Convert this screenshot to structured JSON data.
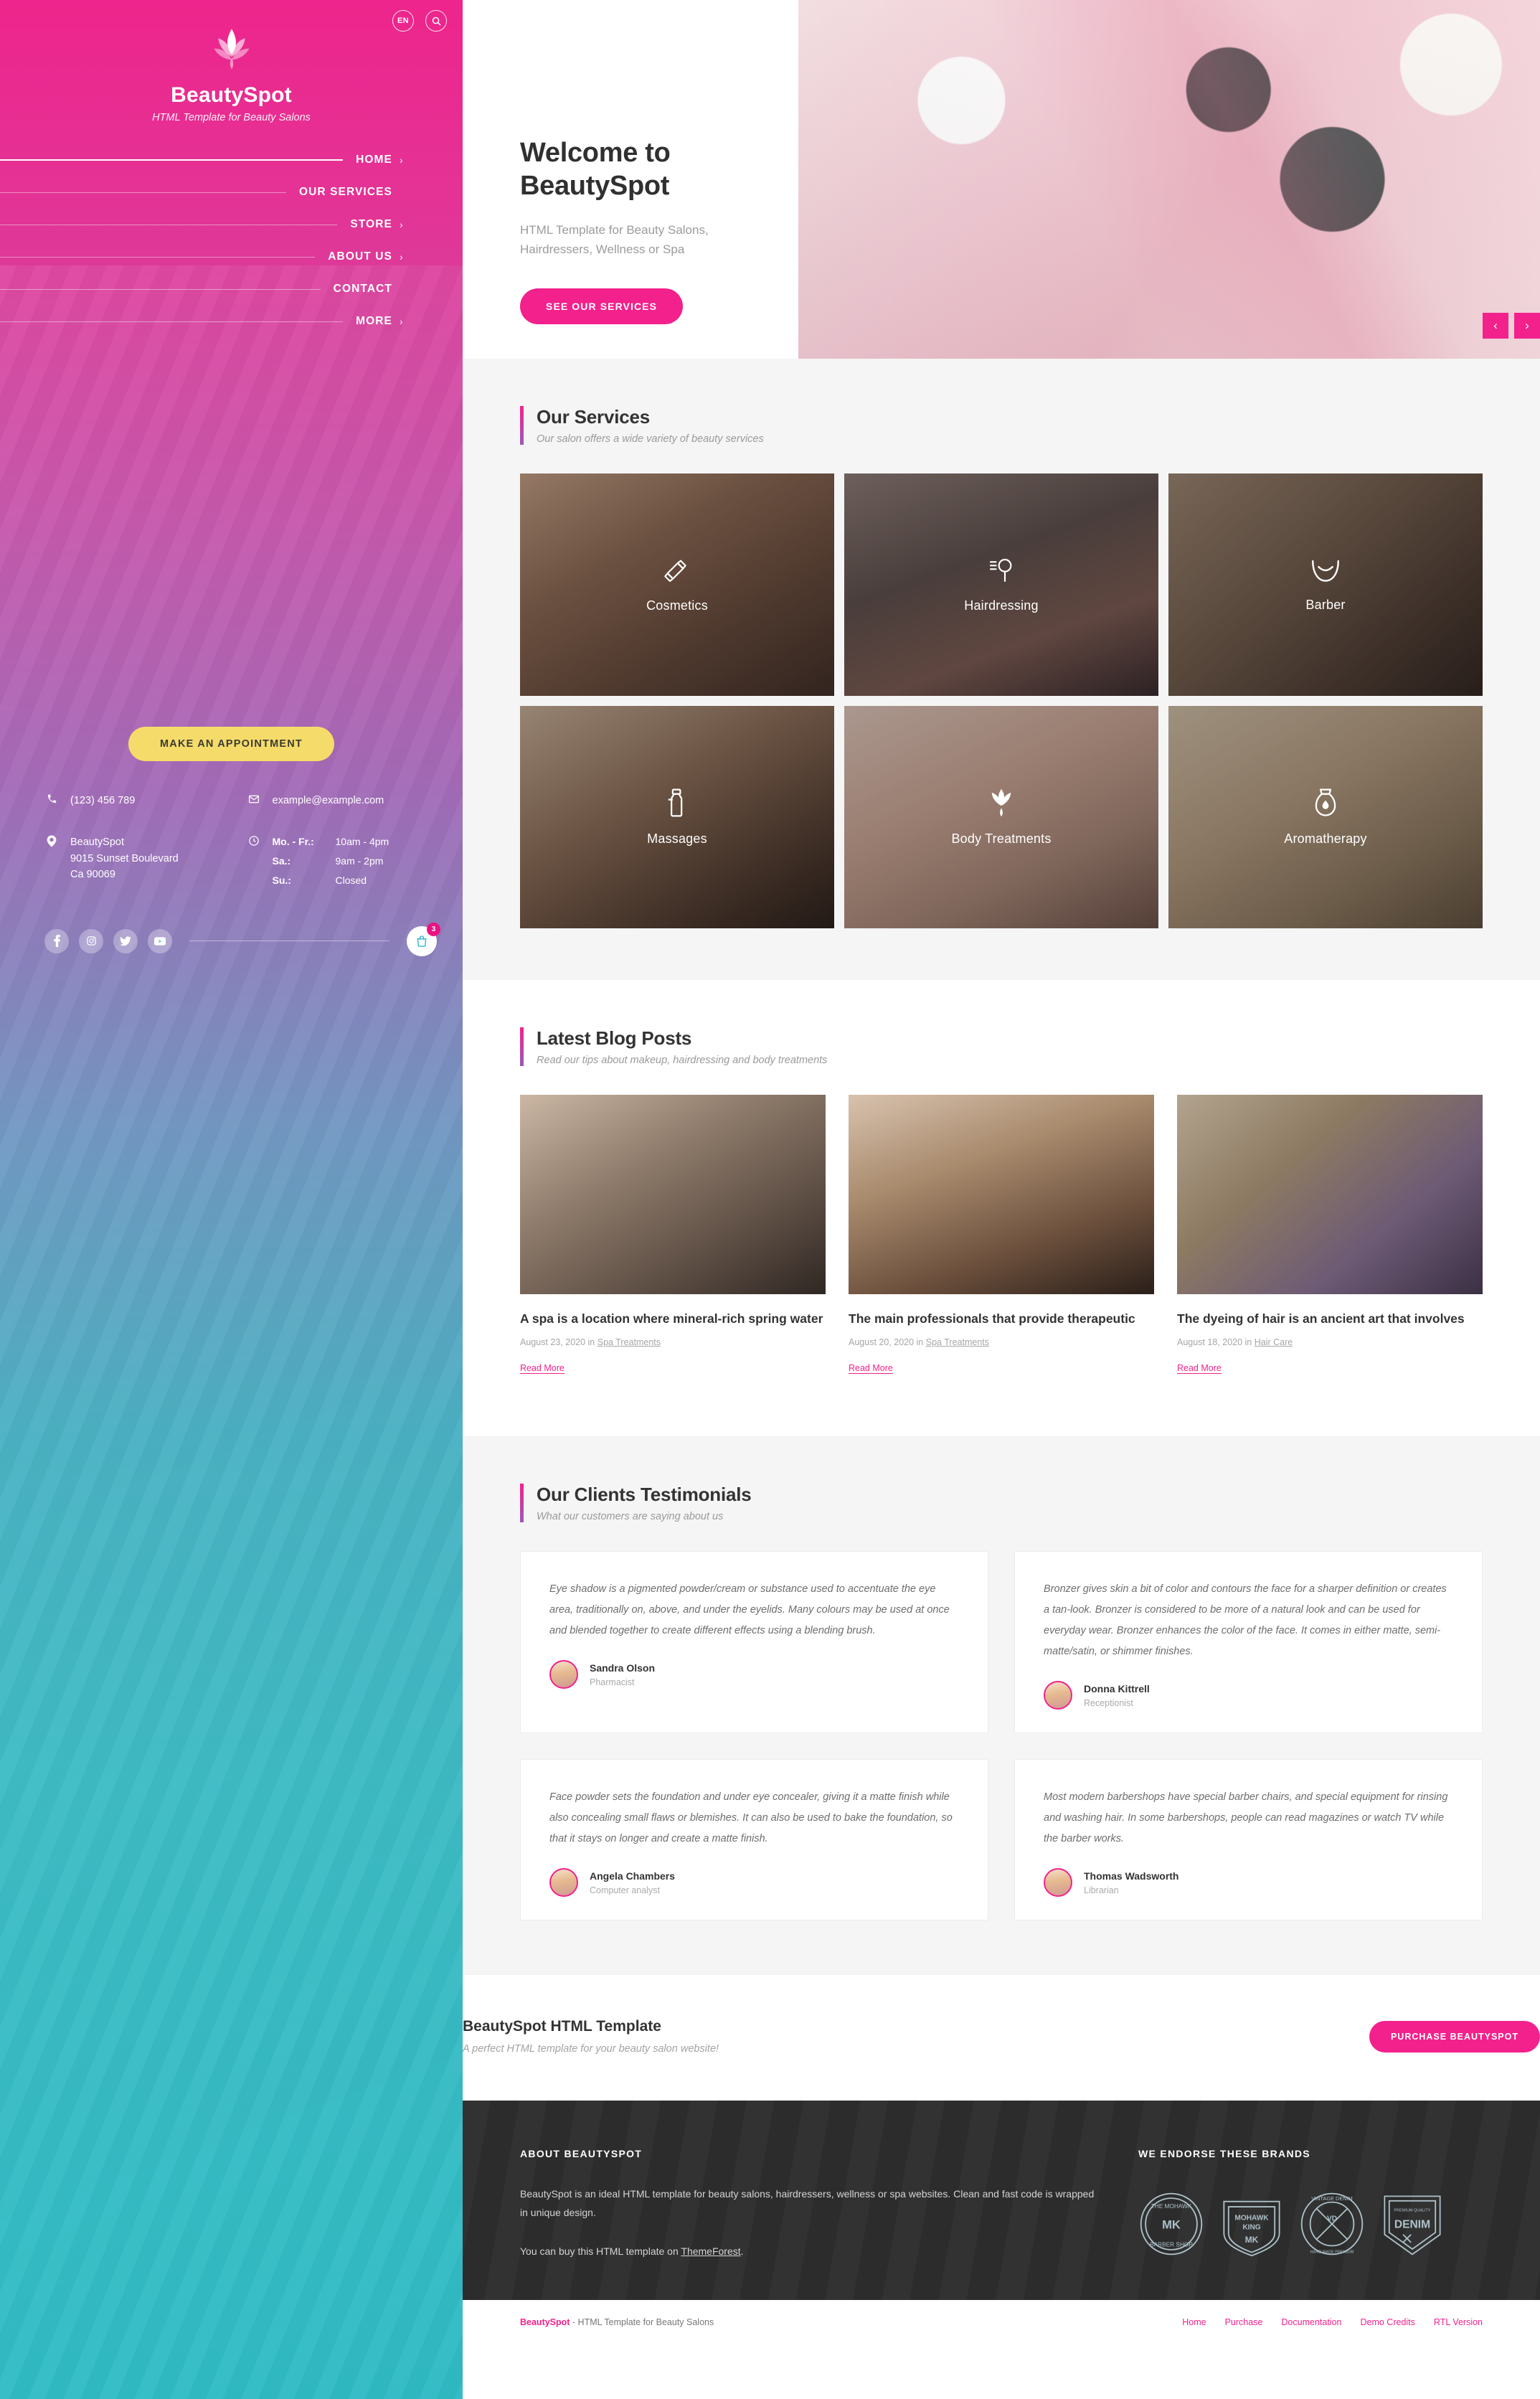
{
  "sidebar": {
    "lang_label": "EN",
    "search_icon": "search-icon",
    "brand_name": "BeautySpot",
    "brand_tagline": "HTML Template for Beauty Salons",
    "nav": [
      {
        "label": "HOME",
        "caret": "›",
        "active": true
      },
      {
        "label": "OUR SERVICES",
        "caret": "",
        "active": false
      },
      {
        "label": "STORE",
        "caret": "›",
        "active": false
      },
      {
        "label": "ABOUT US",
        "caret": "›",
        "active": false
      },
      {
        "label": "CONTACT",
        "caret": "",
        "active": false
      },
      {
        "label": "MORE",
        "caret": "›",
        "active": false
      }
    ],
    "appointment_label": "MAKE AN APPOINTMENT",
    "phone": "(123) 456 789",
    "email": "example@example.com",
    "address_line1": "BeautySpot",
    "address_line2": "9015 Sunset Boulevard",
    "address_line3": "Ca 90069",
    "hours": [
      {
        "day": "Mo. - Fr.:",
        "time": "10am - 4pm"
      },
      {
        "day": "Sa.:",
        "time": "9am - 2pm"
      },
      {
        "day": "Su.:",
        "time": "Closed"
      }
    ],
    "socials": [
      "facebook-icon",
      "instagram-icon",
      "twitter-icon",
      "youtube-icon"
    ],
    "cart_count": "3"
  },
  "hero": {
    "title_line1": "Welcome to",
    "title_line2": "BeautySpot",
    "subtitle": "HTML Template for Beauty Salons, Hairdressers, Wellness or Spa",
    "button_label": "SEE OUR SERVICES",
    "prev_label": "‹",
    "next_label": "›"
  },
  "services": {
    "title": "Our Services",
    "subtitle": "Our salon offers a wide variety of beauty services",
    "items": [
      {
        "name": "Cosmetics",
        "icon": "lipstick-icon"
      },
      {
        "name": "Hairdressing",
        "icon": "hairdryer-icon"
      },
      {
        "name": "Barber",
        "icon": "beard-icon"
      },
      {
        "name": "Massages",
        "icon": "lotion-bottle-icon"
      },
      {
        "name": "Body Treatments",
        "icon": "lotus-flower-icon"
      },
      {
        "name": "Aromatherapy",
        "icon": "oil-diffuser-icon"
      }
    ]
  },
  "blog": {
    "title": "Latest Blog Posts",
    "subtitle": "Read our tips about makeup, hairdressing and body treatments",
    "read_more_label": "Read More",
    "posts": [
      {
        "title": "A spa is a location where mineral-rich spring water",
        "date": "August 23, 2020",
        "in": "in",
        "category": "Spa Treatments"
      },
      {
        "title": "The main professionals that provide therapeutic",
        "date": "August 20, 2020",
        "in": "in",
        "category": "Spa Treatments"
      },
      {
        "title": "The dyeing of hair is an ancient art that involves",
        "date": "August 18, 2020",
        "in": "in",
        "category": "Hair Care"
      }
    ]
  },
  "testimonials": {
    "title": "Our Clients Testimonials",
    "subtitle": "What our customers are saying about us",
    "items": [
      {
        "text": "Eye shadow is a pigmented powder/cream or substance used to accentuate the eye area, traditionally on, above, and under the eyelids. Many colours may be used at once and blended together to create different effects using a blending brush.",
        "name": "Sandra Olson",
        "role": "Pharmacist"
      },
      {
        "text": "Bronzer gives skin a bit of color and contours the face for a sharper definition or creates a tan-look. Bronzer is considered to be more of a natural look and can be used for everyday wear. Bronzer enhances the color of the face. It comes in either matte, semi-matte/satin, or shimmer finishes.",
        "name": "Donna Kittrell",
        "role": "Receptionist"
      },
      {
        "text": "Face powder sets the foundation and under eye concealer, giving it a matte finish while also concealing small flaws or blemishes. It can also be used to bake the foundation, so that it stays on longer and create a matte finish.",
        "name": "Angela Chambers",
        "role": "Computer analyst"
      },
      {
        "text": "Most modern barbershops have special barber chairs, and special equipment for rinsing and washing hair. In some barbershops, people can read magazines or watch TV while the barber works.",
        "name": "Thomas Wadsworth",
        "role": "Librarian"
      }
    ]
  },
  "cta": {
    "title": "BeautySpot HTML Template",
    "subtitle": "A perfect HTML template for your beauty salon website!",
    "button_label": "PURCHASE BEAUTYSPOT"
  },
  "footer": {
    "about_head": "ABOUT BEAUTYSPOT",
    "about_text": "BeautySpot is an ideal HTML template for beauty salons, hairdressers, wellness or spa websites. Clean and fast code is wrapped in unique design.",
    "buy_prefix": "You can buy this HTML template on ",
    "buy_link": "ThemeForest",
    "buy_suffix": ".",
    "brands_head": "WE ENDORSE THESE BRANDS",
    "brands": [
      {
        "name": "the-mohawk-king-barber-shop-badge",
        "line1": "THE MOHAWK KING",
        "line2": "MK",
        "line3": "BARBER SHOP"
      },
      {
        "name": "mohawk-king-shield-badge",
        "line1": "MOHAWK KING",
        "line2": "MK",
        "line3": ""
      },
      {
        "name": "vintage-denim-round-badge",
        "line1": "VINTAGE DENIM",
        "line2": "VD",
        "line3": "HAND MADE PREMIUM QUALITY"
      },
      {
        "name": "denim-shield-badge",
        "line1": "PREMIUM QUALITY",
        "line2": "DENIM",
        "line3": ""
      }
    ],
    "bottom_brand": "BeautySpot",
    "bottom_text": " - HTML Template for Beauty Salons",
    "bottom_links": [
      "Home",
      "Purchase",
      "Documentation",
      "Demo Credits",
      "RTL Version"
    ]
  },
  "colors": {
    "accent_pink": "#f3218c",
    "accent_yellow": "#f5dc6a",
    "dark": "#2e2e2e",
    "muted": "#9a9a9a"
  }
}
